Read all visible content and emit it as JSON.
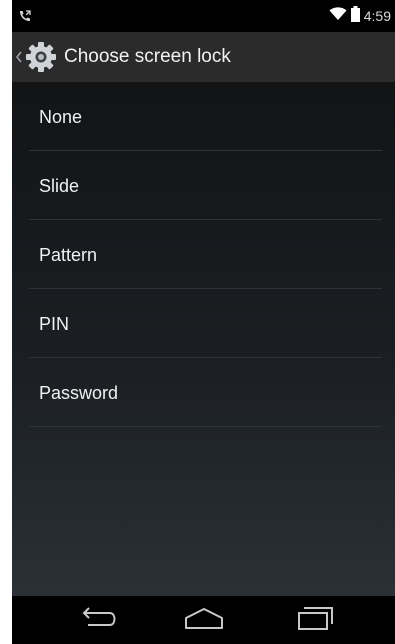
{
  "status_bar": {
    "notification_icon": "phone-call-icon",
    "wifi_icon": "wifi-icon",
    "battery_icon": "battery-icon",
    "time": "4:59"
  },
  "action_bar": {
    "up_icon": "chevron-left-icon",
    "app_icon": "gear-icon",
    "title": "Choose screen lock"
  },
  "options": [
    {
      "label": "None"
    },
    {
      "label": "Slide"
    },
    {
      "label": "Pattern"
    },
    {
      "label": "PIN"
    },
    {
      "label": "Password"
    }
  ],
  "nav_bar": {
    "back_icon": "back-icon",
    "home_icon": "home-icon",
    "recents_icon": "recents-icon"
  },
  "colors": {
    "action_bar_bg": "#2b2b2b",
    "text": "#f0f0f0",
    "divider": "#2e3338"
  }
}
